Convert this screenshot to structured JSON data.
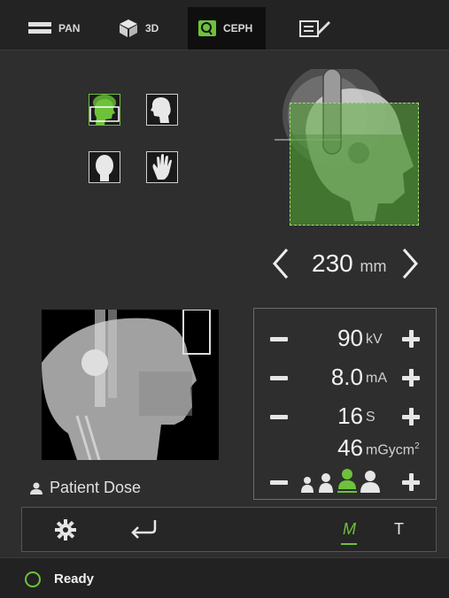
{
  "tabs": [
    {
      "label": "PAN",
      "icon": "pan-bars-icon"
    },
    {
      "label": "3D",
      "icon": "cube-icon"
    },
    {
      "label": "CEPH",
      "icon": "ceph-head-icon"
    },
    {
      "label": "",
      "icon": "report-edit-icon"
    }
  ],
  "active_tab": "CEPH",
  "distance": {
    "value": "230",
    "unit": "mm"
  },
  "params": {
    "kv": {
      "value": "90",
      "unit": "kV"
    },
    "ma": {
      "value": "8.0",
      "unit": "mA"
    },
    "time": {
      "value": "16",
      "unit": "S"
    },
    "dose": {
      "value": "46",
      "unit": "mGycm",
      "sup": "2"
    }
  },
  "patient_dose_label": "Patient Dose",
  "patient_size_selected": 3,
  "bottom": {
    "m_label": "M",
    "t_label": "T"
  },
  "status": {
    "text": "Ready"
  },
  "colors": {
    "accent": "#6ec23a",
    "bg": "#2e2e2e"
  }
}
